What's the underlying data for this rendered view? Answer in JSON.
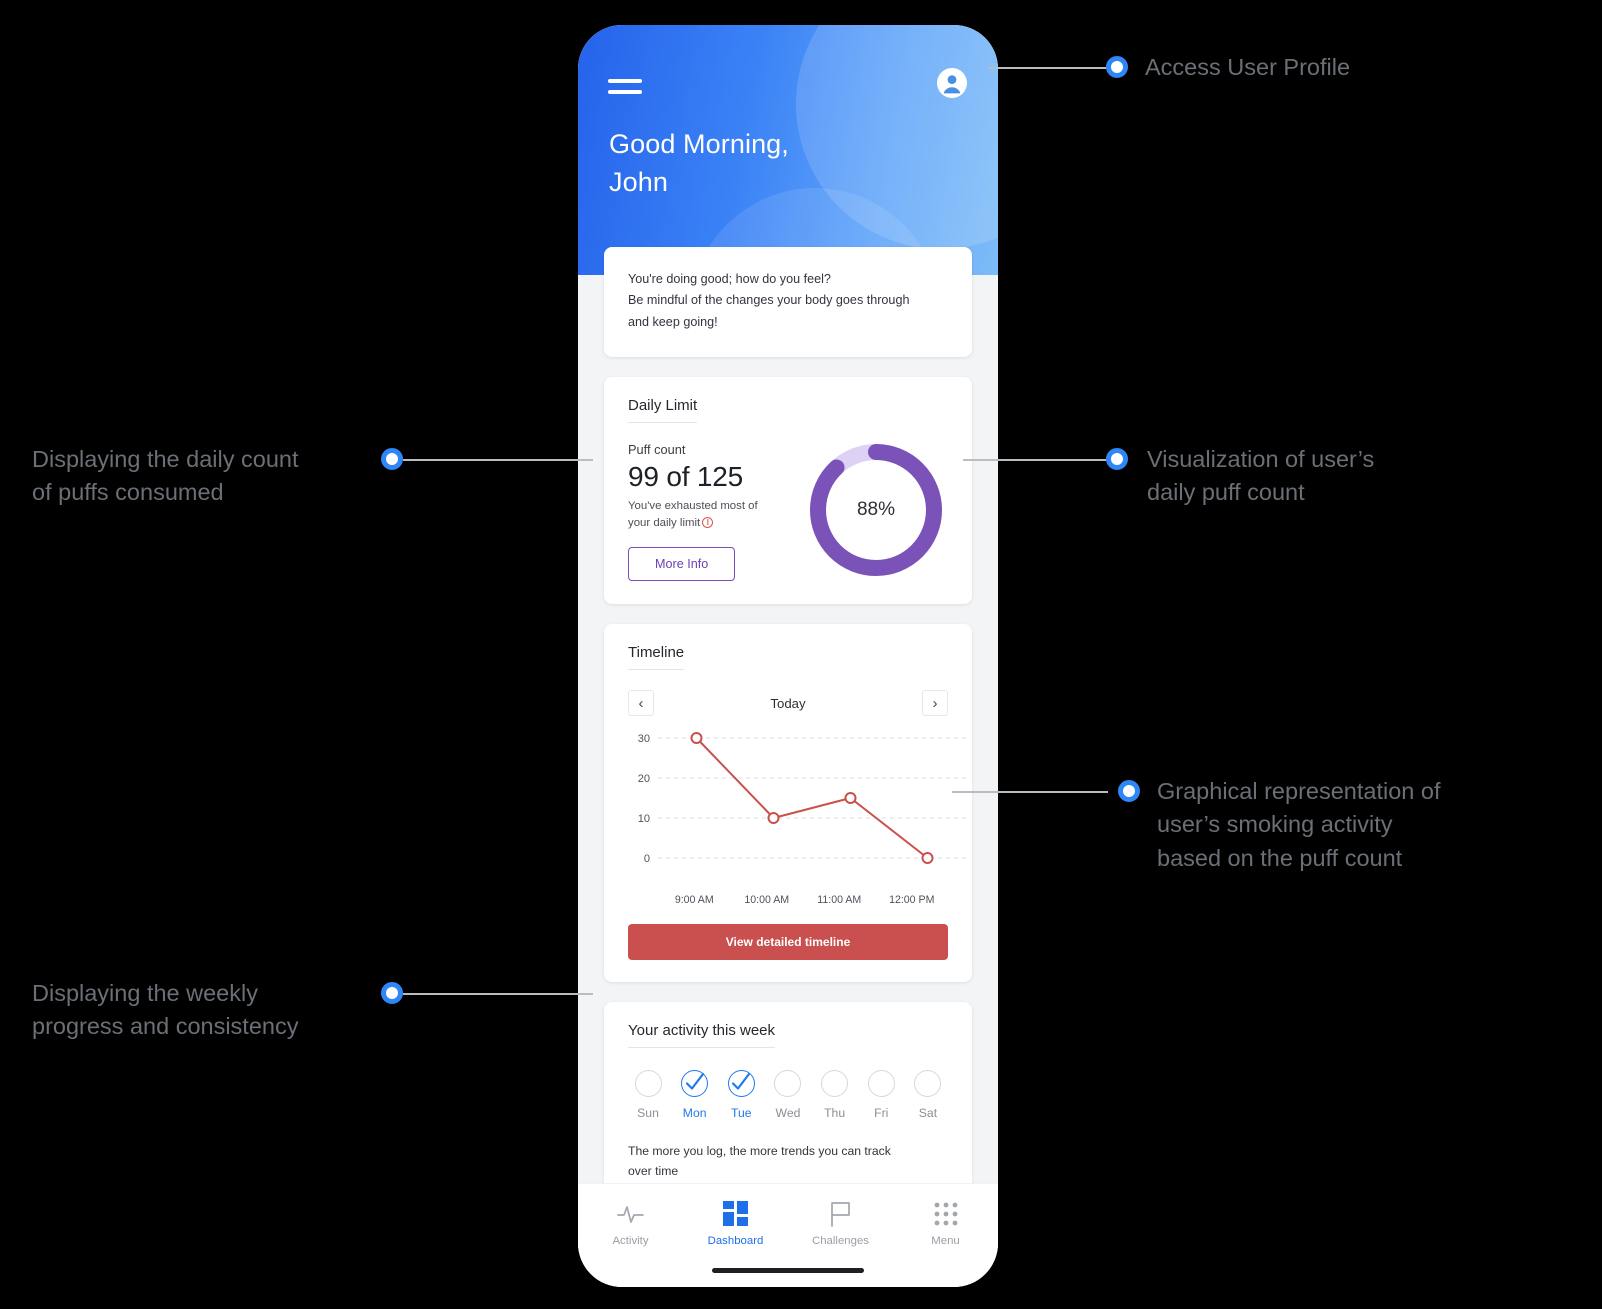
{
  "phone": {
    "header": {
      "menu_icon": "hamburger-icon",
      "profile_icon": "user-avatar-icon",
      "greeting_line1": "Good Morning,",
      "greeting_line2": "John"
    },
    "message_card": {
      "line1": "You're doing good; how do you feel?",
      "line2": "Be mindful of the changes your body goes through",
      "line3": "and keep going!"
    },
    "daily_limit": {
      "title": "Daily Limit",
      "puff_label": "Puff count",
      "count": "99 of 125",
      "note_line1": "You've exhausted most of",
      "note_line2": "your daily limit",
      "info_icon": "info-circle-icon",
      "more_info_label": "More Info",
      "donut_percent_label": "88%",
      "donut_percent_value": 88,
      "donut_color": "#7b52b8",
      "donut_track_color": "#dfd0f5"
    },
    "timeline": {
      "title": "Timeline",
      "prev_icon": "chevron-left-icon",
      "next_icon": "chevron-right-icon",
      "period_label": "Today",
      "view_button_label": "View detailed timeline",
      "view_button_color": "#c9504f"
    },
    "week": {
      "title": "Your activity this week",
      "days": [
        {
          "label": "Sun",
          "logged": false
        },
        {
          "label": "Mon",
          "logged": true
        },
        {
          "label": "Tue",
          "logged": true
        },
        {
          "label": "Wed",
          "logged": false
        },
        {
          "label": "Thu",
          "logged": false
        },
        {
          "label": "Fri",
          "logged": false
        },
        {
          "label": "Sat",
          "logged": false
        }
      ],
      "note_line1": "The more you log, the more trends you can track",
      "note_line2": "over time",
      "active_color": "#1f7aec"
    },
    "bottom_nav": {
      "items": [
        {
          "label": "Activity",
          "icon": "pulse-icon",
          "active": false
        },
        {
          "label": "Dashboard",
          "icon": "grid-icon",
          "active": true
        },
        {
          "label": "Challenges",
          "icon": "flag-icon",
          "active": false
        },
        {
          "label": "Menu",
          "icon": "dots-grid-icon",
          "active": false
        }
      ],
      "active_color": "#1f6fe8"
    }
  },
  "chart_data": {
    "type": "line",
    "title": "Timeline",
    "x": [
      "9:00 AM",
      "10:00 AM",
      "11:00 AM",
      "12:00 PM"
    ],
    "values": [
      30,
      10,
      15,
      0
    ],
    "xlabel": "",
    "ylabel": "",
    "ylim": [
      0,
      30
    ],
    "yticks": [
      0,
      10,
      20,
      30
    ],
    "grid": true,
    "legend": false,
    "series_color": "#cc4f4c",
    "marker": "open-circle"
  },
  "callouts": [
    {
      "id": "profile",
      "line1": "Access User Profile",
      "line2": "",
      "line3": "",
      "side": "right"
    },
    {
      "id": "donut",
      "line1": "Visualization of user’s",
      "line2": "daily puff count",
      "line3": "",
      "side": "right"
    },
    {
      "id": "chart",
      "line1": "Graphical representation of",
      "line2": "user’s smoking activity",
      "line3": "based on the puff count",
      "side": "right"
    },
    {
      "id": "count",
      "line1": "Displaying the daily count",
      "line2": "of puffs consumed",
      "line3": "",
      "side": "left"
    },
    {
      "id": "week",
      "line1": "Displaying the weekly",
      "line2": "progress and consistency",
      "line3": "",
      "side": "left"
    }
  ],
  "colors": {
    "background": "#000000",
    "dot": "#2f86f6",
    "line": "#b9bcc1",
    "text": "#6b6f76"
  }
}
